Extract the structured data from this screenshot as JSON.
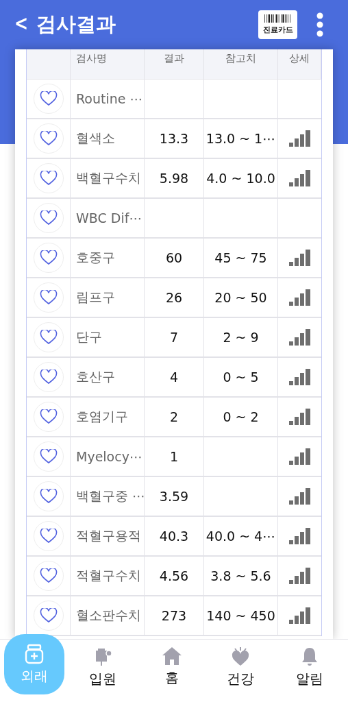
{
  "header": {
    "back_icon": "<",
    "title": "검사결과",
    "card_button": "진료카드"
  },
  "table": {
    "columns": [
      "검사명",
      "결과",
      "참고치",
      "상세"
    ],
    "rows": [
      {
        "name": "Routine ⋯",
        "result": "",
        "reference": "",
        "detail": false
      },
      {
        "name": "혈색소",
        "result": "13.3",
        "reference": "13.0 ~ 1⋯",
        "detail": true
      },
      {
        "name": "백혈구수치",
        "result": "5.98",
        "reference": "4.0 ~ 10.0",
        "detail": true
      },
      {
        "name": "WBC Dif⋯",
        "result": "",
        "reference": "",
        "detail": false
      },
      {
        "name": "호중구",
        "result": "60",
        "reference": "45 ~ 75",
        "detail": true
      },
      {
        "name": "림프구",
        "result": "26",
        "reference": "20 ~ 50",
        "detail": true
      },
      {
        "name": "단구",
        "result": "7",
        "reference": "2 ~ 9",
        "detail": true
      },
      {
        "name": "호산구",
        "result": "4",
        "reference": "0 ~ 5",
        "detail": true
      },
      {
        "name": "호염기구",
        "result": "2",
        "reference": "0 ~ 2",
        "detail": true
      },
      {
        "name": "Myelocy⋯",
        "result": "1",
        "reference": "",
        "detail": true
      },
      {
        "name": "백혈구중 ⋯",
        "result": "3.59",
        "reference": "",
        "detail": true
      },
      {
        "name": "적혈구용적",
        "result": "40.3",
        "reference": "40.0 ~ 4⋯",
        "detail": true
      },
      {
        "name": "적혈구수치",
        "result": "4.56",
        "reference": "3.8 ~ 5.6",
        "detail": true
      },
      {
        "name": "혈소판수치",
        "result": "273",
        "reference": "140 ~ 450",
        "detail": true
      }
    ]
  },
  "nav": [
    {
      "label": "외래",
      "kind": "outpatient",
      "selected": true
    },
    {
      "label": "입원",
      "kind": "inpatient",
      "selected": false
    },
    {
      "label": "홈",
      "kind": "home",
      "selected": false
    },
    {
      "label": "건강",
      "kind": "health",
      "selected": false
    },
    {
      "label": "알림",
      "kind": "alarm",
      "selected": false
    }
  ]
}
